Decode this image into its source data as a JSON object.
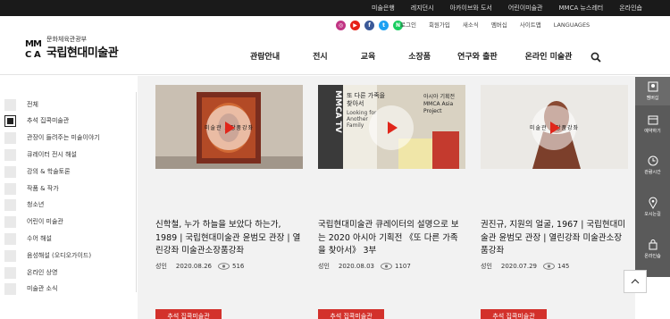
{
  "topbar": {
    "links": [
      "미술은행",
      "레지던시",
      "아카이브와 도서",
      "어린이미술관",
      "MMCA 뉴스레터",
      "온라인숍"
    ]
  },
  "header": {
    "logo_small": "문화체육관광부",
    "logo_big": "국립현대미술관",
    "social": [
      {
        "name": "instagram",
        "color": "#c13584",
        "glyph": "◎"
      },
      {
        "name": "youtube",
        "color": "#e62117",
        "glyph": "▶"
      },
      {
        "name": "facebook",
        "color": "#3b5998",
        "glyph": "f"
      },
      {
        "name": "twitter",
        "color": "#1da1f2",
        "glyph": "t"
      },
      {
        "name": "naver",
        "color": "#19ce60",
        "glyph": "N"
      }
    ],
    "util": [
      "로그인",
      "회원가입",
      "새소식",
      "멤버십",
      "사이트맵",
      "LANGUAGES"
    ],
    "gnb": [
      "관람안내",
      "전시",
      "교육",
      "소장품",
      "연구와 출판",
      "온라인 미술관"
    ]
  },
  "sidebar": {
    "items": [
      {
        "label": "전체",
        "active": false
      },
      {
        "label": "추석 집콕미술관",
        "active": true
      },
      {
        "label": "관장이 들려주는 미술이야기",
        "active": false
      },
      {
        "label": "큐레이터 전시 해설",
        "active": false
      },
      {
        "label": "강의 & 학술토론",
        "active": false
      },
      {
        "label": "작품 & 작가",
        "active": false
      },
      {
        "label": "청소년",
        "active": false
      },
      {
        "label": "어린이 미술관",
        "active": false
      },
      {
        "label": "수어 해설",
        "active": false
      },
      {
        "label": "음성해설 (오디오가이드)",
        "active": false
      },
      {
        "label": "온라인 상영",
        "active": false
      },
      {
        "label": "미술관 소식",
        "active": false
      }
    ]
  },
  "cards": [
    {
      "title": "신학철, 누가 하늘을 보았다 하는가, 1989 | 국립현대미술관 윤범모 관장 | 열린강좌 미술관소장품강좌",
      "audience": "성인",
      "date": "2020.08.26",
      "views": "516",
      "tag": "추석 집콕미술관",
      "thumb_label": "미술관 소장품강좌"
    },
    {
      "title": "국립현대미술관 큐레이터의 설명으로 보는 2020 아시아 기획전 《또 다른 가족을 찾아서》 3부",
      "audience": "성인",
      "date": "2020.08.03",
      "views": "1107",
      "tag": "추석 집콕미술관",
      "thumb_label": "",
      "thumb_text_1": "또 다른 가족을 찾아서",
      "thumb_text_2": "Looking for Another Family",
      "thumb_text_3": "아시아 기획전 MMCA Asia Project",
      "thumb_text_4": "MMCA TV"
    },
    {
      "title": "권진규, 지원의 얼굴, 1967 | 국립현대미술관 윤범모 관장 | 열린강좌 미술관소장품강좌",
      "audience": "성인",
      "date": "2020.07.29",
      "views": "145",
      "tag": "추석 집콕미술관",
      "thumb_label": "미술관 소장품강좌"
    }
  ],
  "quick_menu": [
    "멤버십",
    "예약하기",
    "관람시간",
    "오시는길",
    "온라인숍"
  ],
  "colors": {
    "accent": "#d3312b",
    "sidebar_bg": "#5a5a5a",
    "main_bg": "#f2f2f2"
  }
}
